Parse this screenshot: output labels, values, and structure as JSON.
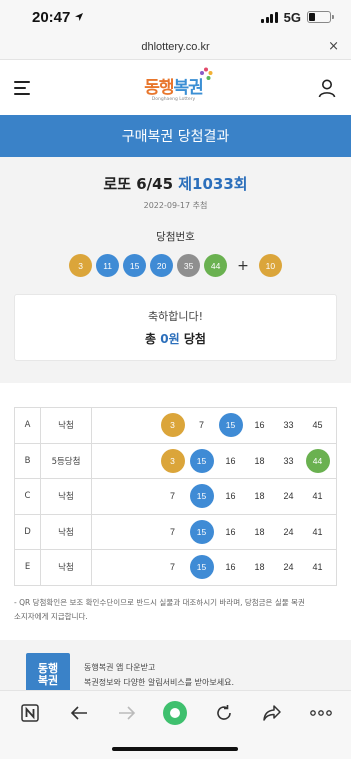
{
  "status_bar": {
    "time": "20:47",
    "network": "5G"
  },
  "url_bar": {
    "url": "dhlottery.co.kr",
    "close_label": "×"
  },
  "header": {
    "logo_text_1": "동행",
    "logo_text_2": "복권",
    "logo_sub": "Donghaeng Lottery"
  },
  "page_title": "구매복권 당첨결과",
  "draw": {
    "game": "로또 6/45",
    "round": "제1033회",
    "date": "2022-09-17 추첨",
    "winning_label": "당첨번호",
    "winning_numbers": [
      "3",
      "11",
      "15",
      "20",
      "35",
      "44"
    ],
    "plus": "+",
    "bonus": "10"
  },
  "congrats": {
    "message": "축하합니다!",
    "prize_prefix": "총",
    "prize_amount": "0원",
    "prize_suffix": "당첨"
  },
  "tickets": [
    {
      "game": "A",
      "result": "낙첨",
      "numbers": [
        "3",
        "7",
        "15",
        "16",
        "33",
        "45"
      ]
    },
    {
      "game": "B",
      "result": "5등당첨",
      "numbers": [
        "3",
        "15",
        "16",
        "18",
        "33",
        "44"
      ]
    },
    {
      "game": "C",
      "result": "낙첨",
      "numbers": [
        "7",
        "15",
        "16",
        "18",
        "24",
        "41"
      ]
    },
    {
      "game": "D",
      "result": "낙첨",
      "numbers": [
        "7",
        "15",
        "16",
        "18",
        "24",
        "41"
      ]
    },
    {
      "game": "E",
      "result": "낙첨",
      "numbers": [
        "7",
        "15",
        "16",
        "18",
        "24",
        "41"
      ]
    }
  ],
  "notice_line_1": "- QR 당첨확인은 보조 확인수단이므로 반드시 실물과 대조하시기 바라며, 당첨금은 실물 복권",
  "notice_line_2": "소지자에게 지급합니다.",
  "promo": {
    "logo_line_1": "동행",
    "logo_line_2": "복권",
    "line_1": "동행복권 앱 다운받고",
    "line_2": "복권정보와 다양한 알림서비스를 받아보세요."
  },
  "colors": {
    "ball_yellow": "#dba53a",
    "ball_blue": "#3f8bd5",
    "ball_red": "#e06a6a",
    "ball_gray": "#8f8f8f",
    "ball_green": "#6ab150",
    "brand_blue": "#3a82c8",
    "browser_green": "#3fc06e"
  }
}
